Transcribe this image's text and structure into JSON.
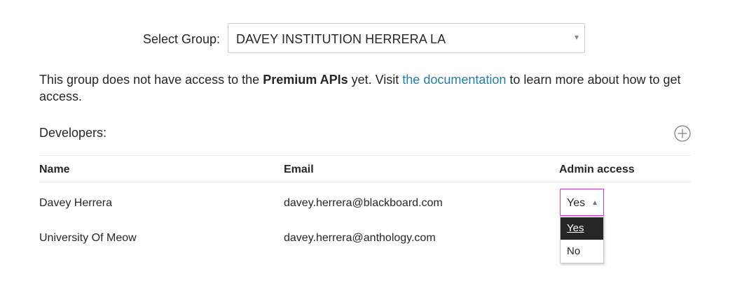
{
  "group": {
    "label": "Select Group:",
    "selected": "DAVEY INSTITUTION HERRERA LA"
  },
  "notice": {
    "before": "This group does not have access to the ",
    "strong": "Premium APIs",
    "middle": " yet. Visit ",
    "link": "the documentation",
    "after": " to learn more about how to get access."
  },
  "developers": {
    "title": "Developers:",
    "add_icon": "plus-circle-icon",
    "columns": [
      "Name",
      "Email",
      "Admin access"
    ],
    "rows": [
      {
        "name": "Davey Herrera",
        "email": "davey.herrera@blackboard.com",
        "admin": "Yes"
      },
      {
        "name": "University Of Meow",
        "email": "davey.herrera@anthology.com"
      }
    ]
  },
  "admin_dropdown": {
    "options": [
      "Yes",
      "No"
    ],
    "selected": "Yes"
  },
  "colors": {
    "link": "#1f7fa6",
    "focus_border": "#c43dc4",
    "selected_option_bg": "#262626"
  }
}
